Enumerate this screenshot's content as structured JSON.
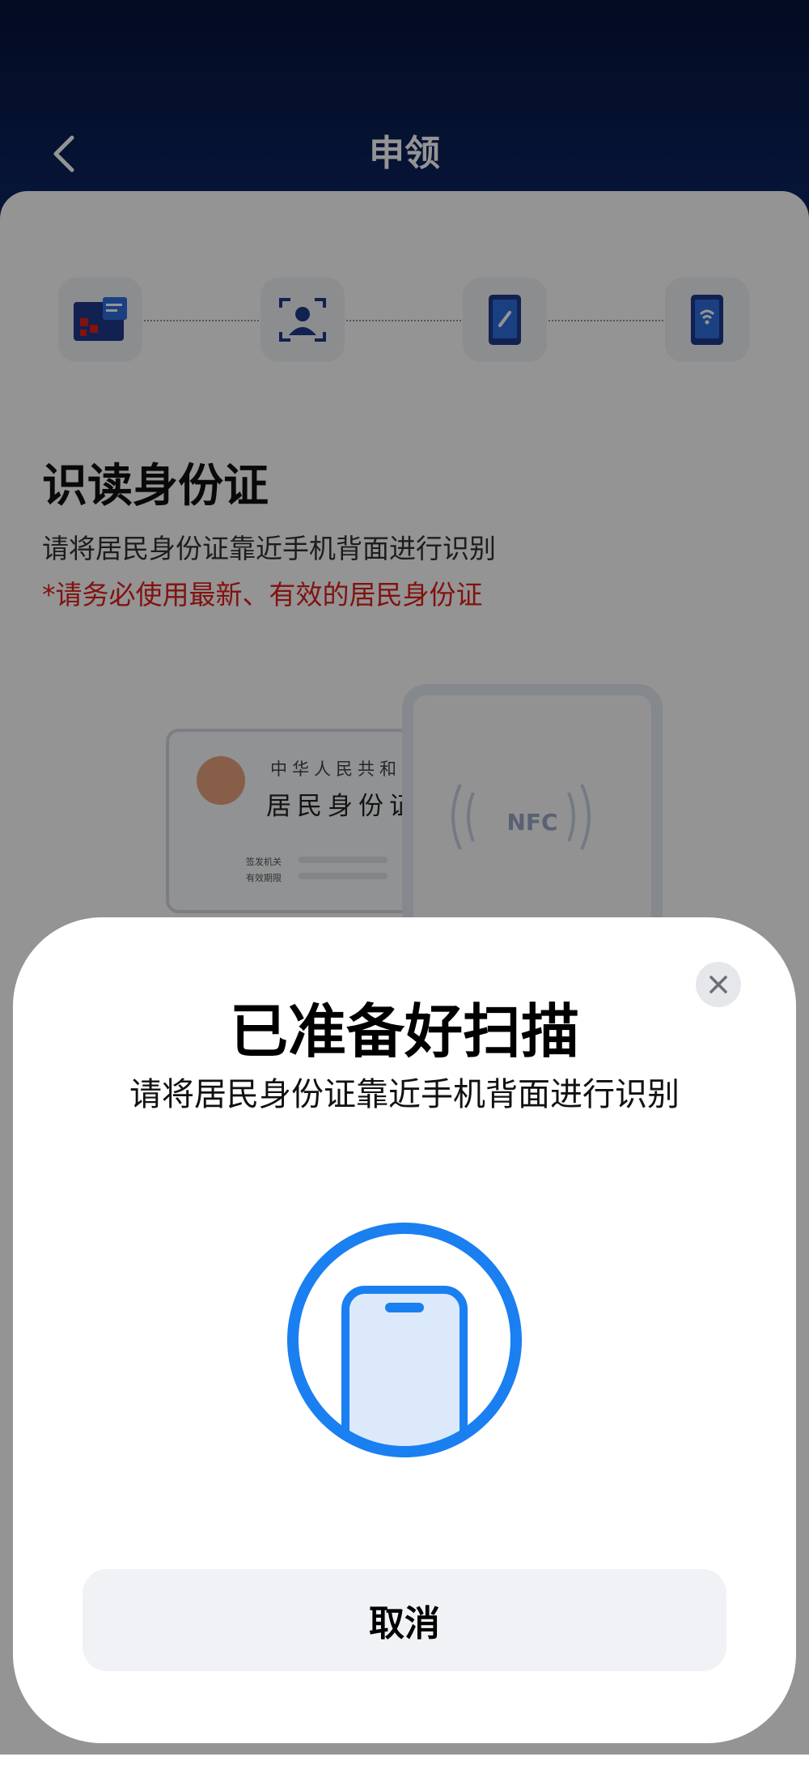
{
  "header": {
    "title": "申领",
    "back_icon": "chevron-left-icon"
  },
  "steps": [
    {
      "icon": "id-card-icon"
    },
    {
      "icon": "face-scan-icon"
    },
    {
      "icon": "phone-link-icon"
    },
    {
      "icon": "phone-nfc-icon"
    }
  ],
  "section": {
    "title": "识读身份证",
    "description": "请将居民身份证靠近手机背面进行识别",
    "warning": "*请务必使用最新、有效的居民身份证"
  },
  "illustration": {
    "card_line1": "中华人民共和国",
    "card_line2": "居民身份证",
    "card_label1": "签发机关",
    "card_label2": "有效期限",
    "nfc_label": "NFC"
  },
  "sheet": {
    "title": "已准备好扫描",
    "description": "请将居民身份证靠近手机背面进行识别",
    "cancel_label": "取消",
    "close_icon": "close-icon",
    "scan_icon": "phone-scan-icon"
  },
  "colors": {
    "header_bg": "#0c2563",
    "warning": "#e0201b",
    "scan_accent": "#1a7ff0"
  }
}
